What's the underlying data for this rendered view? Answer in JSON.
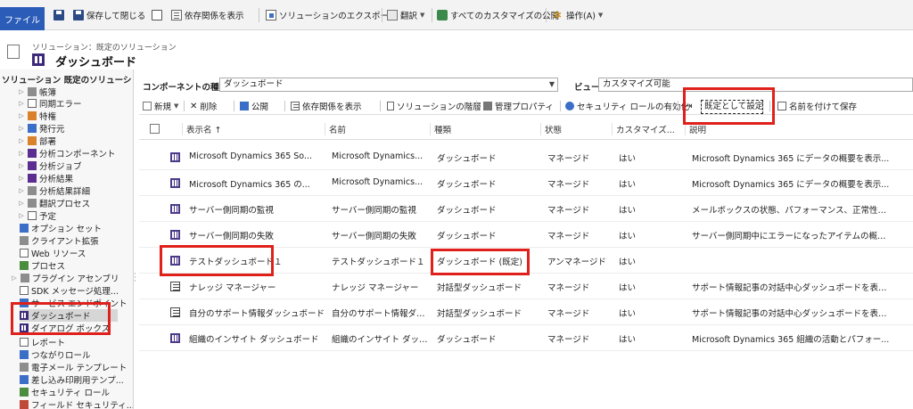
{
  "ribbon": {
    "file": "ファイル",
    "save_close": "保存して閉じる",
    "show_dependencies": "依存関係を表示",
    "export_solution": "ソリューションのエクスポート",
    "translate": "翻訳",
    "publish_all": "すべてのカスタマイズの公開",
    "actions": "操作(A)"
  },
  "breadcrumb": "ソリューション：既定のソリューション",
  "page_title": "ダッシュボード",
  "sidebar": {
    "header": "ソリューション 既定のソリューション",
    "items": [
      "帳簿",
      "同期エラー",
      "特権",
      "発行元",
      "部署",
      "分析コンポーネント",
      "分析ジョブ",
      "分析結果",
      "分析結果詳細",
      "翻訳プロセス",
      "予定",
      "オプション セット",
      "クライアント拡張",
      "Web リソース",
      "プロセス",
      "プラグイン アセンブリ",
      "SDK メッセージ処理...",
      "サービス エンドポイント",
      "ダッシュボード",
      "ダイアログ ボックス",
      "レポート",
      "つながりロール",
      "電子メール テンプレート",
      "差し込み印刷用テンプ...",
      "セキュリティ ロール",
      "フィールド セキュリティ..."
    ]
  },
  "filter": {
    "component_label": "コンポーネントの種類",
    "component_value": "ダッシュボード",
    "view_label": "ビュー",
    "view_value": "カスタマイズ可能"
  },
  "grid_toolbar": {
    "new": "新規",
    "delete": "削除",
    "publish": "公開",
    "show_dependencies": "依存関係を表示",
    "solution_layers": "ソリューションの階層",
    "managed_properties": "管理プロパティ",
    "enable_security_roles": "セキュリティ ロールの有効化",
    "set_default": "既定として設定",
    "save_as": "名前を付けて保存"
  },
  "grid": {
    "columns": [
      "表示名 ↑",
      "名前",
      "種類",
      "状態",
      "カスタマイズ...",
      "説明"
    ],
    "rows": [
      {
        "display": "Microsoft Dynamics 365 So...",
        "name": "Microsoft Dynamics...",
        "type": "ダッシュボード",
        "state": "マネージド",
        "custom": "はい",
        "desc": "Microsoft Dynamics 365 にデータの概要を表示...",
        "icon": "dashboard"
      },
      {
        "display": "Microsoft Dynamics 365 の...",
        "name": "Microsoft Dynamics...",
        "type": "ダッシュボード",
        "state": "マネージド",
        "custom": "はい",
        "desc": "Microsoft Dynamics 365 にデータの概要を表示...",
        "icon": "dashboard"
      },
      {
        "display": "サーバー側同期の監視",
        "name": "サーバー側同期の監視",
        "type": "ダッシュボード",
        "state": "マネージド",
        "custom": "はい",
        "desc": "メールボックスの状態、パフォーマンス、正常性など、サ...",
        "icon": "dashboard"
      },
      {
        "display": "サーバー側同期の失敗",
        "name": "サーバー側同期の失敗",
        "type": "ダッシュボード",
        "state": "マネージド",
        "custom": "はい",
        "desc": "サーバー側同期中にエラーになったアイテムの概要を表...",
        "icon": "dashboard"
      },
      {
        "display": "テストダッシュボード１",
        "name": "テストダッシュボード１",
        "type": "ダッシュボード (既定)",
        "state": "アンマネージド",
        "custom": "はい",
        "desc": "",
        "icon": "dashboard"
      },
      {
        "display": "ナレッジ マネージャー",
        "name": "ナレッジ マネージャー",
        "type": "対話型ダッシュボード",
        "state": "マネージド",
        "custom": "はい",
        "desc": "サポート情報記事の対話中心ダッシュボードを表示し...",
        "icon": "interactive"
      },
      {
        "display": "自分のサポート情報ダッシュボード",
        "name": "自分のサポート情報ダッ...",
        "type": "対話型ダッシュボード",
        "state": "マネージド",
        "custom": "はい",
        "desc": "サポート情報記事の対話中心ダッシュボードを表示し...",
        "icon": "interactive"
      },
      {
        "display": "組織のインサイト ダッシュボード",
        "name": "組織のインサイト ダッシュ...",
        "type": "ダッシュボード",
        "state": "マネージド",
        "custom": "はい",
        "desc": "Microsoft Dynamics 365 組織の活動とパフォー...",
        "icon": "dashboard"
      }
    ]
  }
}
